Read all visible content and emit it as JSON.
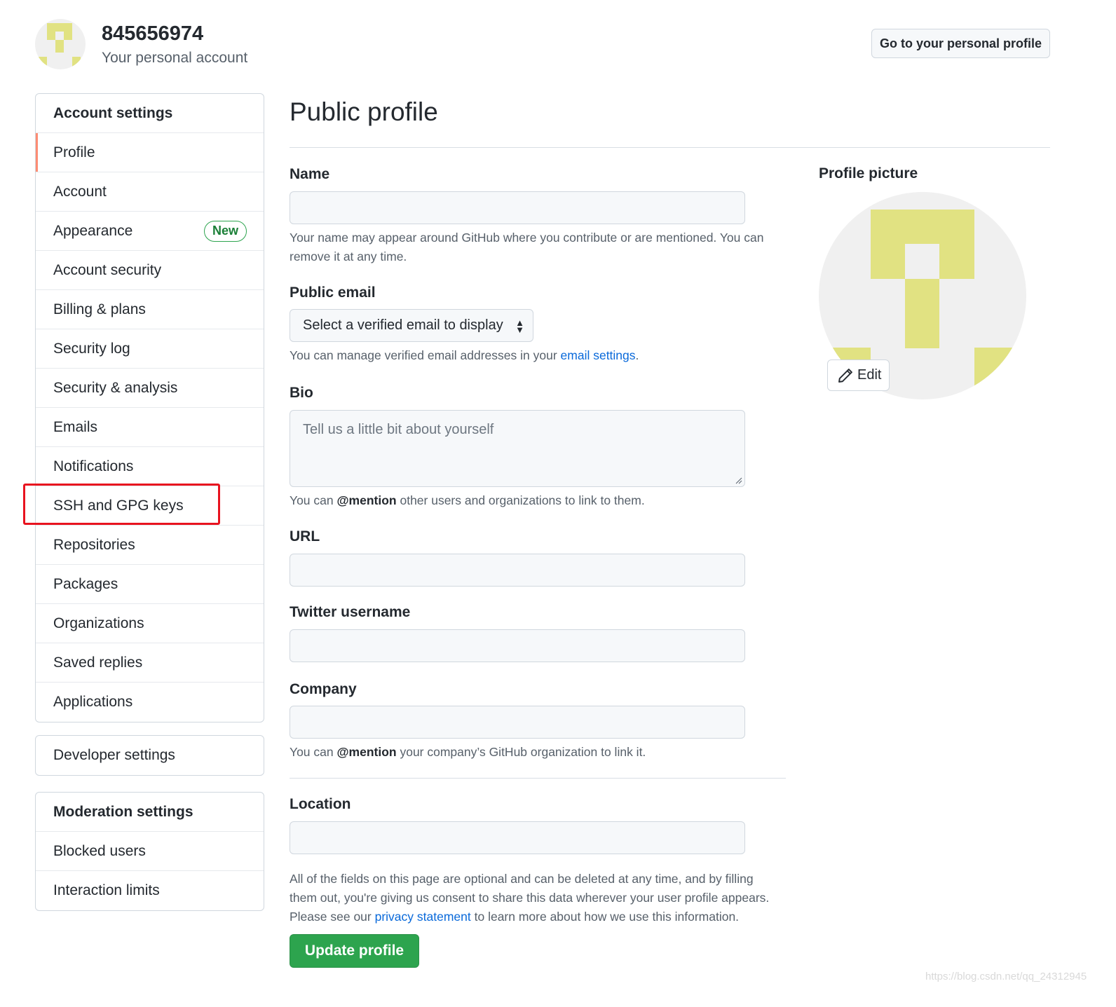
{
  "header": {
    "username": "845656974",
    "subtitle": "Your personal account",
    "profile_button": "Go to your personal profile",
    "avatar_color": "#e1e282"
  },
  "sidebar": {
    "account_menu": {
      "heading": "Account settings",
      "items": [
        {
          "label": "Profile",
          "selected": true
        },
        {
          "label": "Account"
        },
        {
          "label": "Appearance",
          "badge": "New"
        },
        {
          "label": "Account security"
        },
        {
          "label": "Billing & plans"
        },
        {
          "label": "Security log"
        },
        {
          "label": "Security & analysis"
        },
        {
          "label": "Emails"
        },
        {
          "label": "Notifications"
        },
        {
          "label": "SSH and GPG keys",
          "highlighted": true
        },
        {
          "label": "Repositories"
        },
        {
          "label": "Packages"
        },
        {
          "label": "Organizations"
        },
        {
          "label": "Saved replies"
        },
        {
          "label": "Applications"
        }
      ]
    },
    "developer_menu": {
      "item": "Developer settings"
    },
    "moderation_menu": {
      "heading": "Moderation settings",
      "items": [
        {
          "label": "Blocked users"
        },
        {
          "label": "Interaction limits"
        }
      ]
    },
    "highlight_color": "#e8131f",
    "selected_color": "#fd8c73"
  },
  "main": {
    "title": "Public profile",
    "name": {
      "label": "Name",
      "value": "",
      "note": "Your name may appear around GitHub where you contribute or are mentioned. You can remove it at any time."
    },
    "public_email": {
      "label": "Public email",
      "selected": "Select a verified email to display",
      "note_before": "You can manage verified email addresses in your ",
      "note_link": "email settings",
      "note_after": "."
    },
    "bio": {
      "label": "Bio",
      "placeholder": "Tell us a little bit about yourself",
      "note_before": "You can ",
      "note_bold": "@mention",
      "note_after": " other users and organizations to link to them."
    },
    "url": {
      "label": "URL",
      "value": ""
    },
    "twitter": {
      "label": "Twitter username",
      "value": ""
    },
    "company": {
      "label": "Company",
      "value": "",
      "note_before": "You can ",
      "note_bold": "@mention",
      "note_after": " your company’s GitHub organization to link it."
    },
    "location": {
      "label": "Location",
      "value": ""
    },
    "footer_note": {
      "line1": "All of the fields on this page are optional and can be deleted at any time, and by filling",
      "line2": "them out, you're giving us consent to share this data wherever your user profile appears.",
      "line3_before": "Please see our ",
      "line3_link": "privacy statement",
      "line3_after": " to learn more about how we use this information."
    },
    "update_button": "Update profile"
  },
  "profile_picture": {
    "label": "Profile picture",
    "edit_button": "Edit"
  },
  "watermark": "https://blog.csdn.net/qq_24312945",
  "colors": {
    "accent_green": "#2da44e",
    "link_blue": "#0969da",
    "identicon": "#e1e282"
  }
}
